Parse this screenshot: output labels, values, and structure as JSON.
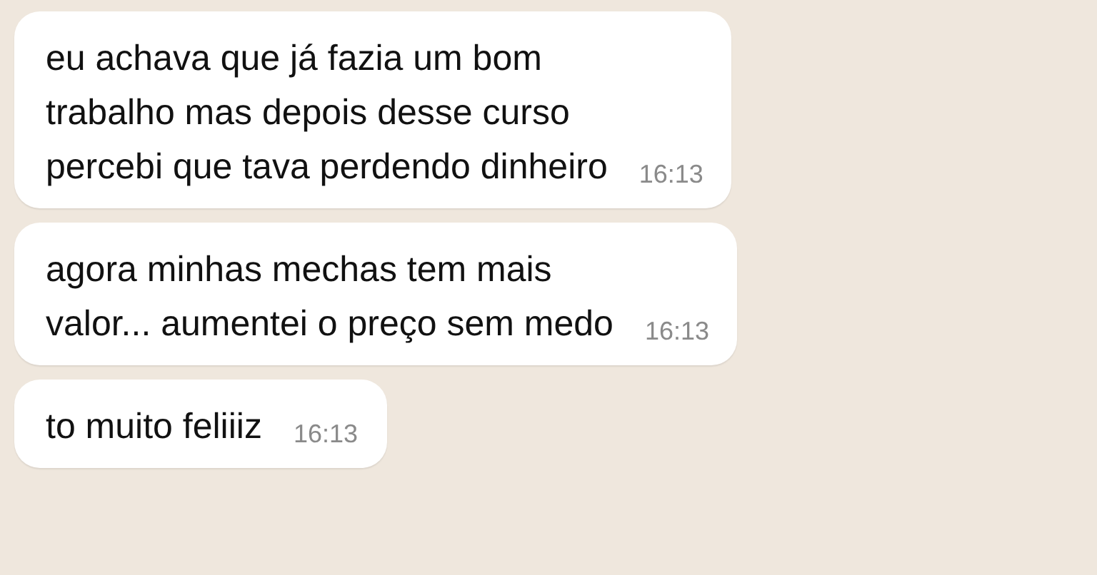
{
  "messages": [
    {
      "text": "eu achava que já fazia um bom\ntrabalho mas depois desse curso\npercebi que tava perdendo dinheiro",
      "time": "16:13"
    },
    {
      "text": "agora minhas mechas tem mais\nvalor... aumentei o preço sem medo",
      "time": "16:13"
    },
    {
      "text": "to muito feliiiz",
      "time": "16:13"
    }
  ]
}
